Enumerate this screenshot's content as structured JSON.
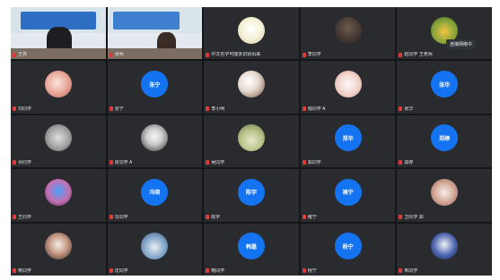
{
  "participants": [
    {
      "type": "camera",
      "variant": "1",
      "name": "王亮"
    },
    {
      "type": "camera",
      "variant": "2",
      "name": "张明"
    },
    {
      "type": "avatar",
      "kind": "img",
      "variant": "15",
      "name": "中文名字可能未识别出来"
    },
    {
      "type": "avatar",
      "kind": "img",
      "variant": "2",
      "name": "李同学"
    },
    {
      "type": "avatar",
      "kind": "img",
      "variant": "3",
      "name": "赵同学  王老师"
    },
    {
      "type": "avatar",
      "kind": "img",
      "variant": "4",
      "name": "刘同学"
    },
    {
      "type": "avatar",
      "kind": "text",
      "label": "张宁",
      "name": "张宁"
    },
    {
      "type": "avatar",
      "kind": "img",
      "variant": "5",
      "name": "李小明"
    },
    {
      "type": "avatar",
      "kind": "img",
      "variant": "6",
      "name": "钱同学  A"
    },
    {
      "type": "avatar",
      "kind": "text",
      "label": "张华",
      "name": "张华"
    },
    {
      "type": "avatar",
      "kind": "img",
      "variant": "7",
      "name": "孙同学"
    },
    {
      "type": "avatar",
      "kind": "img",
      "variant": "8",
      "name": "周同学  A"
    },
    {
      "type": "avatar",
      "kind": "img",
      "variant": "9",
      "name": "吴同学"
    },
    {
      "type": "avatar",
      "kind": "text",
      "label": "郑华",
      "name": "郑同学"
    },
    {
      "type": "avatar",
      "kind": "text",
      "label": "郑婷",
      "name": "郑婷"
    },
    {
      "type": "avatar",
      "kind": "img",
      "variant": "10",
      "name": "王同学"
    },
    {
      "type": "avatar",
      "kind": "text",
      "label": "冯晓",
      "name": "冯同学"
    },
    {
      "type": "avatar",
      "kind": "text",
      "label": "陈宇",
      "name": "陈宇"
    },
    {
      "type": "avatar",
      "kind": "text",
      "label": "褚宁",
      "name": "褚宁"
    },
    {
      "type": "avatar",
      "kind": "img",
      "variant": "11",
      "name": "卫同学  郑"
    },
    {
      "type": "avatar",
      "kind": "img",
      "variant": "12",
      "name": "蒋同学"
    },
    {
      "type": "avatar",
      "kind": "img",
      "variant": "13",
      "name": "沈同学"
    },
    {
      "type": "avatar",
      "kind": "text",
      "label": "韩磊",
      "name": "韩同学"
    },
    {
      "type": "avatar",
      "kind": "text",
      "label": "杨宁",
      "name": "杨宁"
    },
    {
      "type": "avatar",
      "kind": "img",
      "variant": "14",
      "name": "朱同学"
    }
  ],
  "tooltip": "连接网络中",
  "colors": {
    "background": "#1f2024",
    "tile": "#2a2b2f",
    "avatarBlue": "#1473f0",
    "mutedMic": "#e03b3b"
  }
}
